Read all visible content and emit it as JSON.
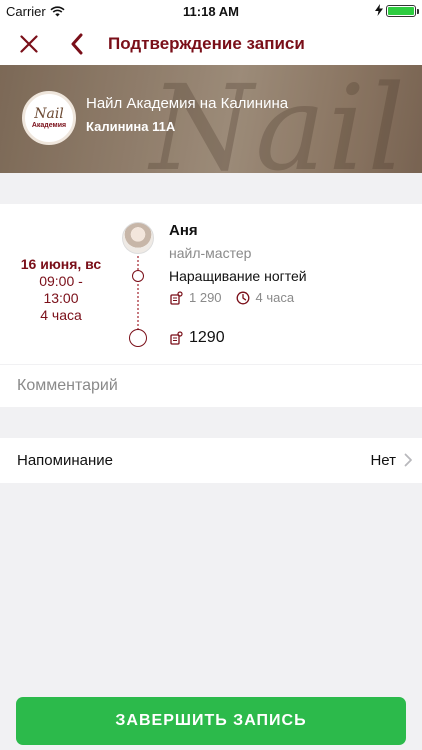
{
  "status_bar": {
    "carrier": "Carrier",
    "time": "11:18 AM",
    "battery_level": 1.0
  },
  "header": {
    "title": "Подтверждение записи"
  },
  "salon": {
    "name": "Найл Академия на Калинина",
    "address": "Калинина 11А",
    "logo_text_1": "Nail",
    "logo_text_2": "Академия",
    "watermark": "Nail"
  },
  "booking": {
    "date": "16 июня, вс",
    "time_from": "09:00 -",
    "time_to": "13:00",
    "duration": "4 часа",
    "master_name": "Аня",
    "master_role": "найл-мастер",
    "service_name": "Наращивание ногтей",
    "service_price": "1 290",
    "service_duration": "4 часа",
    "total": "1290"
  },
  "comment": {
    "placeholder": "Комментарий",
    "value": ""
  },
  "reminder": {
    "label": "Напоминание",
    "value": "Нет"
  },
  "finish_button": {
    "label": "ЗАВЕРШИТЬ ЗАПИСЬ"
  },
  "colors": {
    "accent": "#7a0f19",
    "success": "#2cba4b",
    "background": "#f1f1f3"
  },
  "icons": {
    "close": "close-icon",
    "back": "chevron-left-icon",
    "price": "price-tag-icon",
    "clock": "clock-icon",
    "chevron_right": "chevron-right-icon"
  }
}
